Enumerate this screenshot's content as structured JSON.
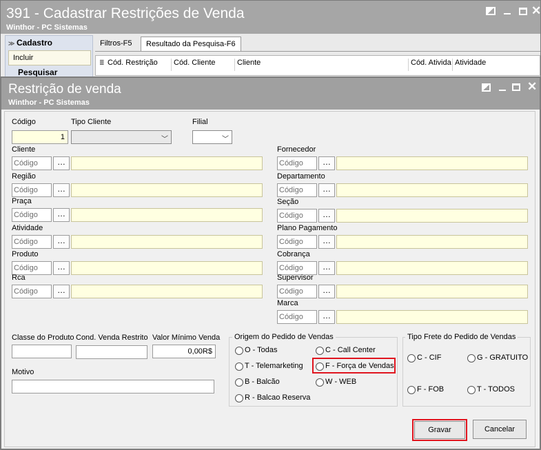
{
  "outer": {
    "title": "391 - Cadastrar Restrições de Venda",
    "subtitle": "Winthor - PC Sistemas",
    "sidebar": {
      "header": "Cadastro",
      "incluir": "Incluir",
      "pesquisar": "Pesquisar"
    },
    "tabs": [
      "Filtros-F5",
      "Resultado da Pesquisa-F6"
    ],
    "grid_columns": [
      "Cód. Restrição",
      "Cód. Cliente",
      "Cliente",
      "Cód. Ativida",
      "Atividade"
    ]
  },
  "dialog": {
    "title": "Restrição de venda",
    "subtitle": "Winthor - PC Sistemas",
    "codigo": {
      "label": "Código",
      "value": "1"
    },
    "tipo_cliente": {
      "label": "Tipo Cliente",
      "value": ""
    },
    "filial": {
      "label": "Filial",
      "value": ""
    },
    "code_placeholder": "Código",
    "lookups_left": [
      "Cliente",
      "Região",
      "Praça",
      "Atividade",
      "Produto",
      "Rca"
    ],
    "lookups_right": [
      "Fornecedor",
      "Departamento",
      "Seção",
      "Plano Pagamento",
      "Cobrança",
      "Supervisor",
      "Marca"
    ],
    "classe_produto": {
      "label": "Classe do Produto",
      "value": ""
    },
    "cond_venda": {
      "label": "Cond. Venda Restrito",
      "value": ""
    },
    "valor_minimo": {
      "label": "Valor Mínimo Venda",
      "value": "0,00R$"
    },
    "motivo": {
      "label": "Motivo",
      "value": ""
    },
    "origem": {
      "title": "Origem do Pedido de Vendas",
      "options": [
        "O - Todas",
        "C - Call Center",
        "T - Telemarketing",
        "F - Força de Vendas",
        "B - Balcão",
        "W - WEB",
        "R - Balcao Reserva"
      ]
    },
    "frete": {
      "title": "Tipo Frete do Pedido de Vendas",
      "options": [
        "C - CIF",
        "G - GRATUITO",
        "F - FOB",
        "T - TODOS"
      ]
    },
    "buttons": {
      "gravar": "Gravar",
      "cancelar": "Cancelar"
    },
    "highlight_color": "#e0141e"
  }
}
